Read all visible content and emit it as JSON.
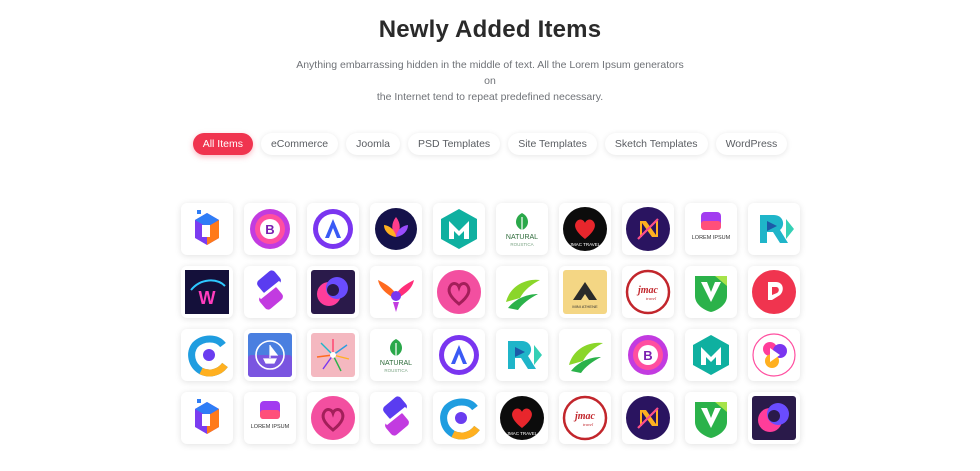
{
  "header": {
    "title": "Newly Added Items",
    "subtitle_line1": "Anything embarrassing hidden in the middle of text. All the Lorem Ipsum generators on",
    "subtitle_line2": "the Internet tend to repeat predefined necessary."
  },
  "filters": {
    "active_color": "#f0344f",
    "items": [
      {
        "label": "All Items",
        "active": true
      },
      {
        "label": "eCommerce",
        "active": false
      },
      {
        "label": "Joomla",
        "active": false
      },
      {
        "label": "PSD Templates",
        "active": false
      },
      {
        "label": "Site Templates",
        "active": false
      },
      {
        "label": "Sketch Templates",
        "active": false
      },
      {
        "label": "WordPress",
        "active": false
      }
    ]
  },
  "logo_texts": {
    "natural": "NATURAL",
    "natural_sub": "ROUSTICA",
    "jmac": "JMAC TRAVEL",
    "lorem": "LOREM IPSUM",
    "mini": "MINI ATHENE"
  },
  "items": [
    {
      "icon": "hex-cube-logo-icon"
    },
    {
      "icon": "b-rose-logo-icon"
    },
    {
      "icon": "a-circle-logo-icon"
    },
    {
      "icon": "lotus-logo-icon"
    },
    {
      "icon": "m-hexagon-logo-icon"
    },
    {
      "icon": "natural-leaf-logo-icon",
      "text": "natural"
    },
    {
      "icon": "heart-travel-logo-icon",
      "text": "jmac"
    },
    {
      "icon": "n-diamond-logo-icon"
    },
    {
      "icon": "lorem-square-logo-icon",
      "text": "lorem"
    },
    {
      "icon": "r-play-logo-icon"
    },
    {
      "icon": "w-swoosh-logo-icon"
    },
    {
      "icon": "stripe-diamond-logo-icon"
    },
    {
      "icon": "dark-swirl-logo-icon"
    },
    {
      "icon": "phoenix-logo-icon"
    },
    {
      "icon": "heart-bubble-logo-icon"
    },
    {
      "icon": "green-swoosh-logo-icon"
    },
    {
      "icon": "mountain-logo-icon",
      "text": "mini"
    },
    {
      "icon": "jmac-circle-logo-icon",
      "text": "jmac"
    },
    {
      "icon": "v-shield-logo-icon"
    },
    {
      "icon": "d-hand-logo-icon"
    },
    {
      "icon": "c-eye-logo-icon"
    },
    {
      "icon": "ship-badge-logo-icon"
    },
    {
      "icon": "fireworks-logo-icon"
    },
    {
      "icon": "natural-leaf-logo-icon",
      "text": "natural"
    },
    {
      "icon": "a-circle-logo-icon"
    },
    {
      "icon": "r-play-logo-icon"
    },
    {
      "icon": "green-swoosh-logo-icon"
    },
    {
      "icon": "b-rose-logo-icon"
    },
    {
      "icon": "m-hexagon-logo-icon"
    },
    {
      "icon": "play-flower-logo-icon"
    },
    {
      "icon": "hex-cube-logo-icon"
    },
    {
      "icon": "lorem-square-logo-icon",
      "text": "lorem"
    },
    {
      "icon": "heart-bubble-logo-icon"
    },
    {
      "icon": "stripe-diamond-logo-icon"
    },
    {
      "icon": "c-eye-logo-icon"
    },
    {
      "icon": "heart-travel-logo-icon",
      "text": "jmac"
    },
    {
      "icon": "jmac-circle-logo-icon",
      "text": "jmac"
    },
    {
      "icon": "n-diamond-logo-icon"
    },
    {
      "icon": "v-shield-logo-icon"
    },
    {
      "icon": "dark-swirl-logo-icon"
    }
  ]
}
